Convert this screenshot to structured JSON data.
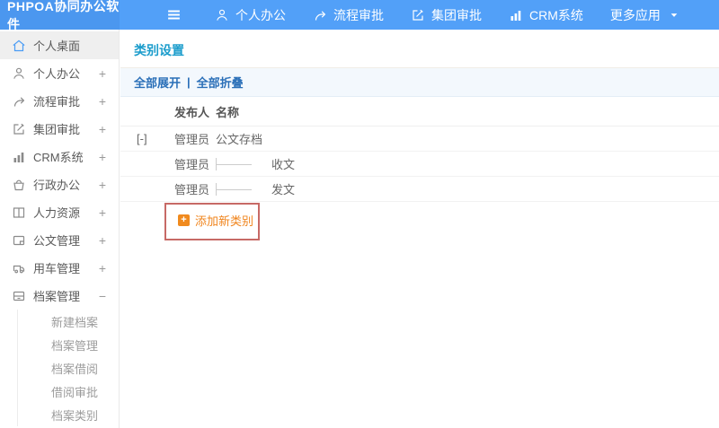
{
  "topbar": {
    "logo": "PHPOA协同办公软件",
    "nav": [
      {
        "label": "个人办公",
        "icon": "user-icon"
      },
      {
        "label": "流程审批",
        "icon": "flow-icon"
      },
      {
        "label": "集团审批",
        "icon": "edit-icon"
      },
      {
        "label": "CRM系统",
        "icon": "chart-icon"
      },
      {
        "label": "更多应用",
        "icon": "caret-down-icon"
      }
    ]
  },
  "sidebar": {
    "items": [
      {
        "label": "个人桌面",
        "icon": "home-icon",
        "expander": ""
      },
      {
        "label": "个人办公",
        "icon": "user-icon",
        "expander": "+"
      },
      {
        "label": "流程审批",
        "icon": "flow-icon",
        "expander": "+"
      },
      {
        "label": "集团审批",
        "icon": "edit-icon",
        "expander": "+"
      },
      {
        "label": "CRM系统",
        "icon": "chart-icon",
        "expander": "+"
      },
      {
        "label": "行政办公",
        "icon": "basket-icon",
        "expander": "+"
      },
      {
        "label": "人力资源",
        "icon": "book-icon",
        "expander": "+"
      },
      {
        "label": "公文管理",
        "icon": "document-icon",
        "expander": "+"
      },
      {
        "label": "用车管理",
        "icon": "truck-icon",
        "expander": "+"
      },
      {
        "label": "档案管理",
        "icon": "archive-icon",
        "expander": "−"
      }
    ],
    "subitems": [
      {
        "label": "新建档案"
      },
      {
        "label": "档案管理"
      },
      {
        "label": "档案借阅"
      },
      {
        "label": "借阅审批"
      },
      {
        "label": "档案类别"
      }
    ]
  },
  "main": {
    "title": "类别设置",
    "toolbar": {
      "expand_all": "全部展开",
      "separator": "|",
      "collapse_all": "全部折叠"
    },
    "table": {
      "headers": {
        "publisher": "发布人",
        "name": "名称"
      },
      "rows": [
        {
          "expander": "[-]",
          "publisher": "管理员",
          "name": "公文存档"
        },
        {
          "expander": "",
          "publisher": "管理员",
          "name": "收文"
        },
        {
          "expander": "",
          "publisher": "管理员",
          "name": "发文"
        }
      ]
    },
    "add_button": {
      "label": "添加新类别",
      "icon": "plus-icon"
    }
  },
  "colors": {
    "topbar_blue": "#52a0f8",
    "logo_blue": "#4b97ef",
    "title_teal": "#1c9dcc",
    "link_blue": "#2a6fb8",
    "accent_orange": "#f0841c",
    "annotation_red": "#c76a66"
  }
}
